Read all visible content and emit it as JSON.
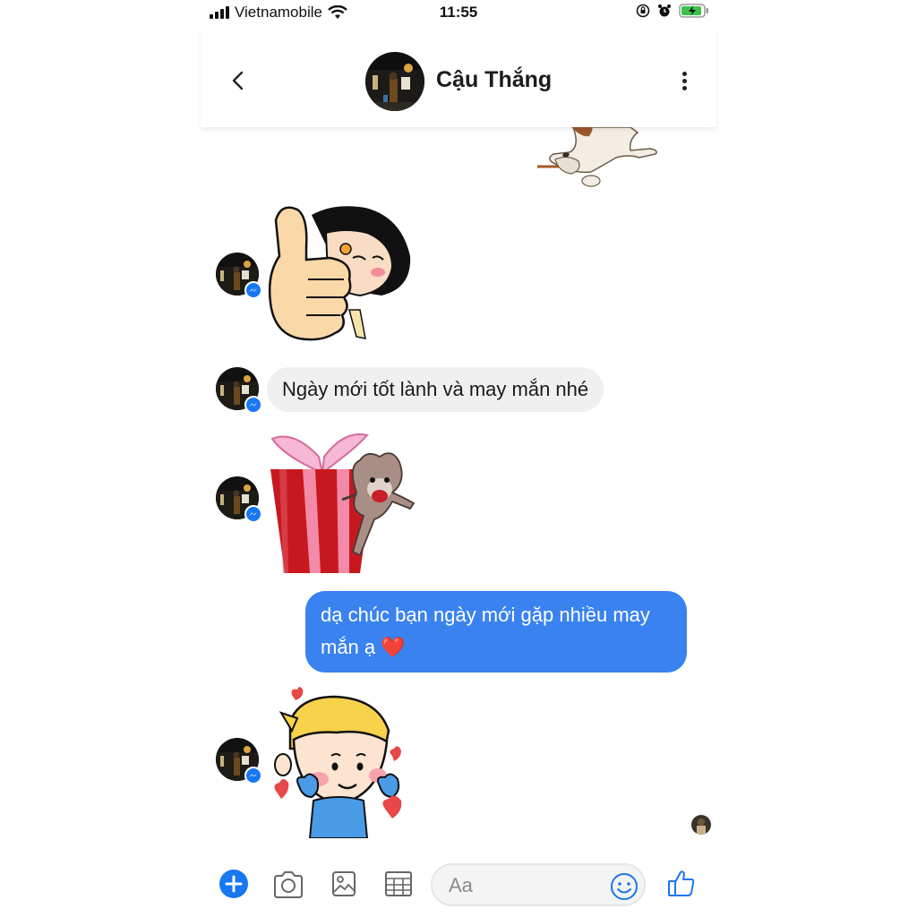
{
  "status_bar": {
    "carrier": "Vietnamobile",
    "time": "11:55"
  },
  "header": {
    "contact_name": "Cậu Thắng"
  },
  "messages": {
    "incoming_text": "Ngày mới tốt lành và may mắn nhé",
    "outgoing_text": "dạ chúc bạn ngày mới gặp nhiều may mắn ạ ❤️"
  },
  "composer": {
    "placeholder": "Aa"
  },
  "colors": {
    "accent": "#1877f2",
    "outgoing_bubble": "#3a82f0",
    "incoming_bubble": "#f0f0f0"
  },
  "icons": [
    "signal-icon",
    "wifi-icon",
    "rotation-lock-icon",
    "alarm-icon",
    "battery-icon",
    "back-arrow-icon",
    "more-vertical-icon",
    "messenger-badge-icon",
    "plus-icon",
    "camera-icon",
    "image-icon",
    "grid-icon",
    "emoji-icon",
    "thumbs-up-icon"
  ]
}
